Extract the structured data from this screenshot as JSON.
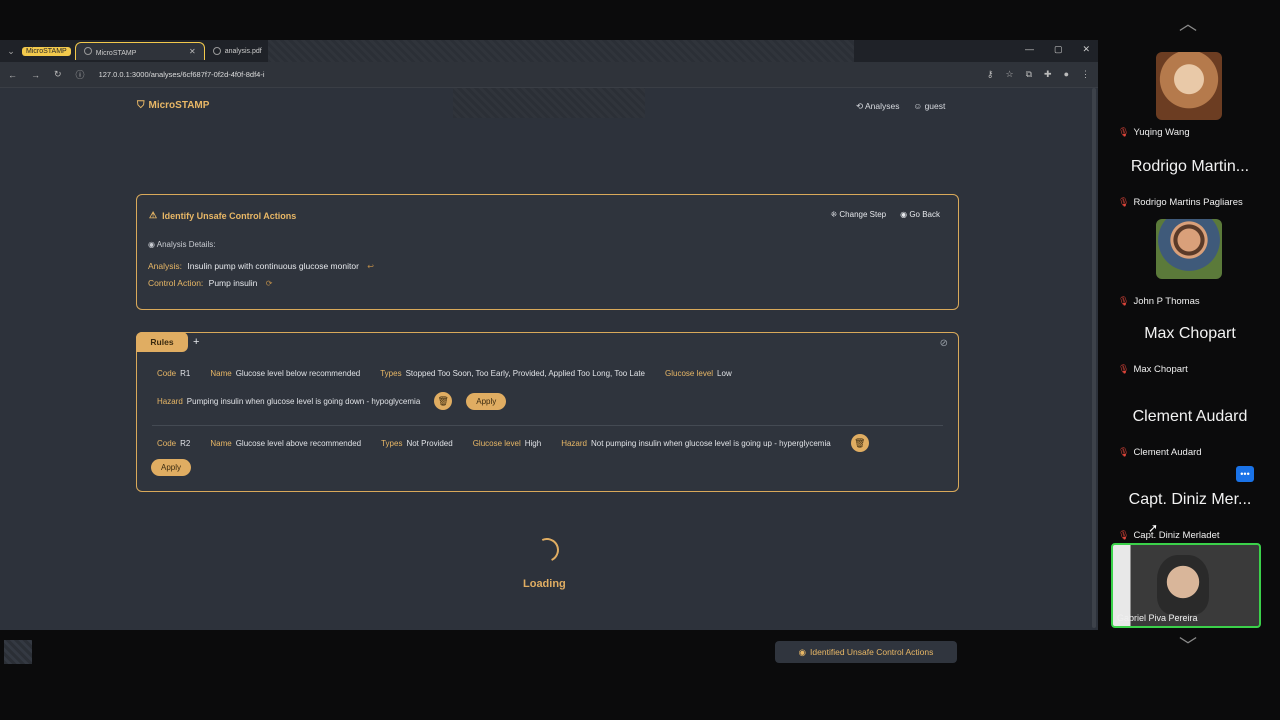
{
  "browser": {
    "tab_group": "MicroSTAMP",
    "tabs": [
      {
        "label": "MicroSTAMP"
      },
      {
        "label": "analysis.pdf"
      }
    ],
    "url": "127.0.0.1:3000/analyses/6cf687f7-0f2d-4f0f-8df4-i"
  },
  "app": {
    "logo": "MicroSTAMP",
    "nav": {
      "analyses": "Analyses",
      "user": "guest"
    },
    "step_card": {
      "title": "Identify Unsafe Control Actions",
      "change_step": "Change Step",
      "go_back": "Go Back",
      "details_label": "Analysis Details:",
      "analysis_key": "Analysis:",
      "analysis_value": "Insulin pump with continuous glucose monitor",
      "control_action_key": "Control Action:",
      "control_action_value": "Pump insulin"
    },
    "rules_card": {
      "tab": "Rules",
      "add": "+",
      "rules": [
        {
          "code_key": "Code",
          "code": "R1",
          "name_key": "Name",
          "name": "Glucose level below recommended",
          "types_key": "Types",
          "types": "Stopped Too Soon, Too Early, Provided, Applied Too Long, Too Late",
          "var_key": "Glucose level",
          "var": "Low",
          "hazard_key": "Hazard",
          "hazard": "Pumping insulin when glucose level is going down - hypoglycemia",
          "apply": "Apply"
        },
        {
          "code_key": "Code",
          "code": "R2",
          "name_key": "Name",
          "name": "Glucose level above recommended",
          "types_key": "Types",
          "types": "Not Provided",
          "var_key": "Glucose level",
          "var": "High",
          "hazard_key": "Hazard",
          "hazard": "Not pumping insulin when glucose level is going up - hyperglycemia",
          "apply": "Apply"
        }
      ]
    },
    "loading": "Loading",
    "identified_button": "Identified Unsafe Control Actions"
  },
  "meeting": {
    "participants": [
      {
        "name": "Yuqing Wang",
        "display": ""
      },
      {
        "name": "Rodrigo Martins Pagliares",
        "display": "Rodrigo Martin..."
      },
      {
        "name": "John P Thomas",
        "display": ""
      },
      {
        "name": "Max Chopart",
        "display": "Max Chopart"
      },
      {
        "name": "Clement Audard",
        "display": "Clement Audard"
      },
      {
        "name": "Capt. Diniz Merladet",
        "display": "Capt. Diniz Mer..."
      }
    ],
    "self": {
      "name": "Gabriel Piva Pereira"
    },
    "more_icon": "ellipsis-icon"
  },
  "colors": {
    "accent": "#e0ad62",
    "background": "#2d323b",
    "active_speaker": "#3bd14a"
  }
}
